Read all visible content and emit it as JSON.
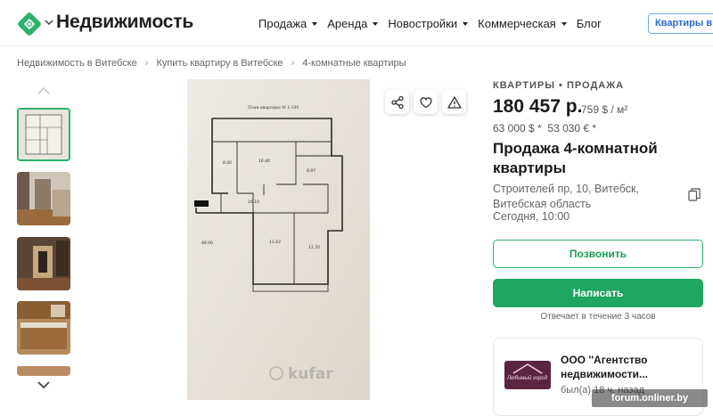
{
  "header": {
    "logo_text": "Недвижимость",
    "nav": [
      {
        "label": "Продажа",
        "has_caret": true
      },
      {
        "label": "Аренда",
        "has_caret": true
      },
      {
        "label": "Новостройки",
        "has_caret": true
      },
      {
        "label": "Коммерческая",
        "has_caret": true
      },
      {
        "label": "Блог",
        "has_caret": false
      }
    ],
    "cta_label": "Квартиры в Минске"
  },
  "breadcrumbs": [
    "Недвижимость в Витебске",
    "Купить квартиру в Витебске",
    "4-комнатные квартиры"
  ],
  "gallery": {
    "up_icon": "chevron-up-icon",
    "down_icon": "chevron-down-icon",
    "main_watermark": "kufar",
    "floorplan_caption": "План квартиры М 1:100"
  },
  "actions": {
    "share_icon": "share-icon",
    "favorite_icon": "heart-icon",
    "report_icon": "warning-icon"
  },
  "listing": {
    "category": "КВАРТИРЫ • ПРОДАЖА",
    "price": "180 457 р.",
    "price_per_sq": "759 $ / м²",
    "price_usd": "63 000 $ *",
    "price_eur": "53 030 € *",
    "title": "Продажа 4-комнатной квартиры",
    "address": "Строителей пр, 10, Витебск, Витебская область",
    "date": "Сегодня, 10:00"
  },
  "contact": {
    "call_label": "Позвонить",
    "write_label": "Написать",
    "reply_time": "Отвечает в течение 3 часов"
  },
  "seller": {
    "name": "ООО ''Агентство недвижимости...",
    "logo_text": "Любимый город",
    "online": "был(а) 18 ч. назад"
  },
  "site_watermark": "forum.onliner.by",
  "colors": {
    "brand_green": "#1fa661",
    "link_blue": "#2a6bd1"
  }
}
